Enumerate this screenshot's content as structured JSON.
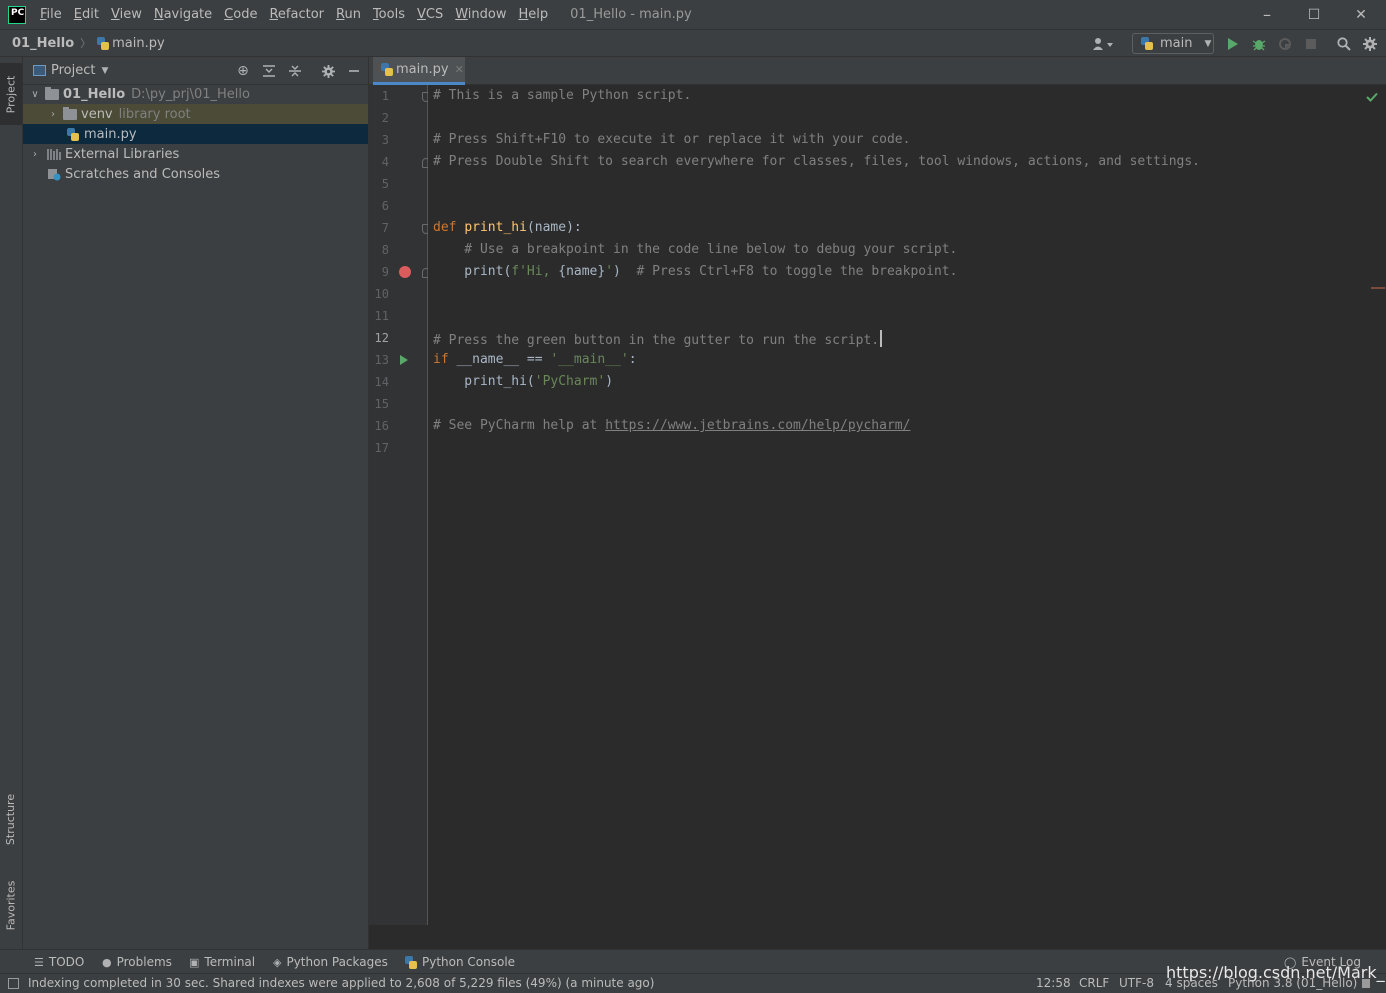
{
  "window": {
    "title": "01_Hello - main.py",
    "menu": [
      "File",
      "Edit",
      "View",
      "Navigate",
      "Code",
      "Refactor",
      "Run",
      "Tools",
      "VCS",
      "Window",
      "Help"
    ],
    "logo_text": "PC",
    "controls": {
      "minimize": "–",
      "maximize": "☐",
      "close": "✕"
    }
  },
  "navbar": {
    "project": "01_Hello",
    "file": "main.py",
    "run_config": "main"
  },
  "left_strip": {
    "project_tab": "Project",
    "structure_tab": "Structure",
    "favorites_tab": "Favorites"
  },
  "project_panel": {
    "title": "Project",
    "tree": [
      {
        "label": "01_Hello",
        "hint": "D:\\py_prj\\01_Hello",
        "bold": true
      },
      {
        "label": "venv",
        "hint": "library root"
      },
      {
        "label": "main.py",
        "hint": ""
      },
      {
        "label": "External Libraries",
        "hint": ""
      },
      {
        "label": "Scratches and Consoles",
        "hint": ""
      }
    ]
  },
  "editor": {
    "tab": "main.py",
    "active_line": 12,
    "line_numbers": [
      "1",
      "2",
      "3",
      "4",
      "5",
      "6",
      "7",
      "8",
      "9",
      "10",
      "11",
      "12",
      "13",
      "14",
      "15",
      "16",
      "17"
    ],
    "lines": {
      "l1": "# This is a sample Python script.",
      "l3": "# Press Shift+F10 to execute it or replace it with your code.",
      "l4": "# Press Double Shift to search everywhere for classes, files, tool windows, actions, and settings.",
      "l7_kw": "def ",
      "l7_fn": "print_hi",
      "l7_rest": "(name):",
      "l8": "    # Use a breakpoint in the code line below to debug your script.",
      "l9_call": "    print(",
      "l9_str1": "f'Hi, ",
      "l9_var": "{name}",
      "l9_str2": "'",
      "l9_close": ")  ",
      "l9_cmt": "# Press Ctrl+F8 to toggle the breakpoint.",
      "l12": "# Press the green button in the gutter to run the script.",
      "l13_kw": "if ",
      "l13_mid": "__name__ == ",
      "l13_str": "'__main__'",
      "l13_end": ":",
      "l14_call": "    print_hi(",
      "l14_str": "'PyCharm'",
      "l14_end": ")",
      "l16_cmt": "# See PyCharm help at ",
      "l16_url": "https://www.jetbrains.com/help/pycharm/"
    }
  },
  "bottom_tools": [
    "TODO",
    "Problems",
    "Terminal",
    "Python Packages",
    "Python Console",
    "Event Log"
  ],
  "status": {
    "message": "Indexing completed in 30 sec. Shared indexes were applied to 2,608 of 5,229 files (49%) (a minute ago)",
    "position": "12:58",
    "line_sep": "CRLF",
    "encoding": "UTF-8",
    "indent": "4 spaces",
    "interpreter": "Python 3.8 (01_Hello)"
  },
  "watermark": "https://blog.csdn.net/Mark_md",
  "colors": {
    "background": "#2b2b2b",
    "panel": "#3c3f41",
    "keyword": "#cc7832",
    "function": "#ffc66d",
    "string": "#6a8759",
    "comment": "#808080",
    "breakpoint": "#db5c5c",
    "run": "#59a869"
  }
}
